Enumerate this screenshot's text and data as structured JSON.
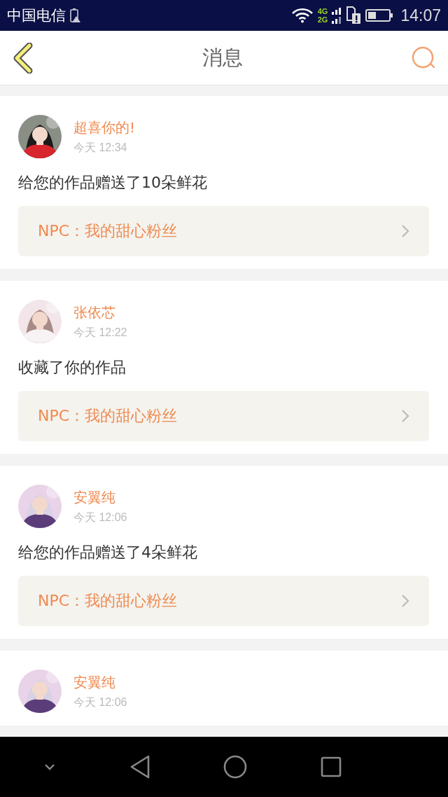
{
  "status_bar": {
    "carrier": "中国电信",
    "network_top": "4G",
    "network_bottom": "2G",
    "time": "14:07"
  },
  "header": {
    "title": "消息"
  },
  "messages": [
    {
      "name": "超喜你的!",
      "time": "今天 12:34",
      "text": "给您的作品赠送了10朵鲜花",
      "link": "NPC：我的甜心粉丝"
    },
    {
      "name": "张依芯",
      "time": "今天 12:22",
      "text": "收藏了你的作品",
      "link": "NPC：我的甜心粉丝"
    },
    {
      "name": "安翼纯",
      "time": "今天 12:06",
      "text": "给您的作品赠送了4朵鲜花",
      "link": "NPC：我的甜心粉丝"
    },
    {
      "name": "安翼纯",
      "time": "今天 12:06"
    }
  ]
}
